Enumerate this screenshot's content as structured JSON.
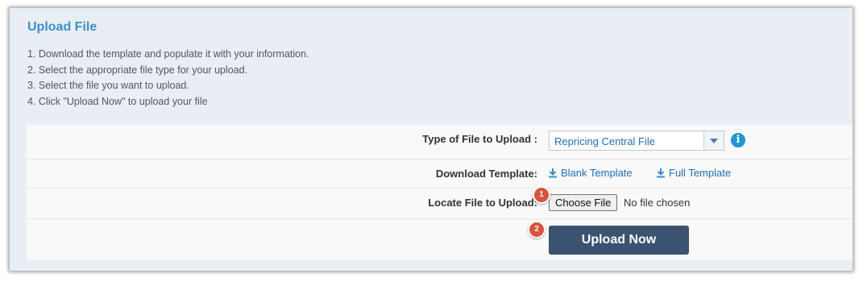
{
  "title": "Upload File",
  "instructions": [
    "1. Download the template and populate it with your information.",
    "2. Select the appropriate file type for your upload.",
    "3. Select the file you want to upload.",
    "4. Click \"Upload Now\" to upload your file"
  ],
  "form": {
    "file_type_label": "Type of File to Upload :",
    "file_type_value": "Repricing Central File",
    "info_icon": "info-icon",
    "download_label": "Download Template:",
    "blank_template": "Blank Template",
    "full_template": "Full Template",
    "locate_label": "Locate File to Upload:",
    "choose_file": "Choose File",
    "no_file": "No file chosen",
    "upload_button": "Upload Now"
  },
  "badges": [
    "1",
    "2"
  ],
  "colors": {
    "title": "#3a8fd0",
    "link": "#1f6fb5",
    "upload_button": "#3b5371",
    "badge": "#d9533d",
    "info": "#1f95d6"
  }
}
